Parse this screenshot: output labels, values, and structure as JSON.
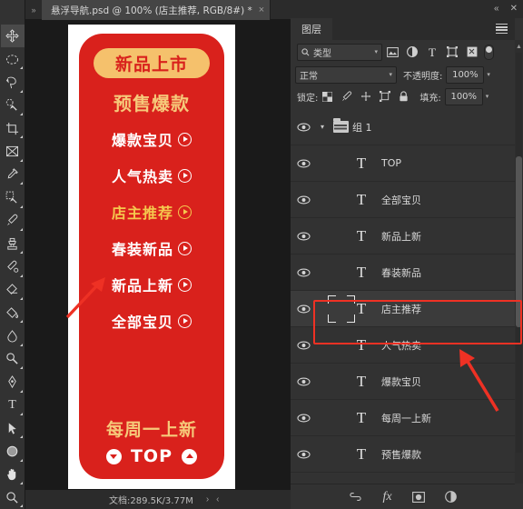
{
  "document": {
    "tab_title": "悬浮导航.psd @ 100% (店主推荐, RGB/8#) *",
    "close_label": "×",
    "nav_arrows_label": "»",
    "status_text": "文档:289.5K/3.77M",
    "status_next": "›",
    "status_prev": "‹"
  },
  "toolbar": {
    "tools": [
      {
        "name": "move-tool",
        "active": true
      },
      {
        "name": "elliptical-marquee-tool",
        "active": false
      },
      {
        "name": "lasso-tool",
        "active": false
      },
      {
        "name": "quick-selection-tool",
        "active": false
      },
      {
        "name": "crop-tool",
        "active": false
      },
      {
        "name": "frame-tool",
        "active": false
      },
      {
        "name": "eyedropper-tool",
        "active": false
      },
      {
        "name": "spot-healing-brush-tool",
        "active": false
      },
      {
        "name": "brush-tool",
        "active": false
      },
      {
        "name": "clone-stamp-tool",
        "active": false
      },
      {
        "name": "history-brush-tool",
        "active": false
      },
      {
        "name": "eraser-tool",
        "active": false
      },
      {
        "name": "paint-bucket-tool",
        "active": false
      },
      {
        "name": "blur-tool",
        "active": false
      },
      {
        "name": "dodge-tool",
        "active": false
      },
      {
        "name": "pen-tool",
        "active": false
      },
      {
        "name": "horizontal-type-tool",
        "active": false
      },
      {
        "name": "path-selection-tool",
        "active": false
      },
      {
        "name": "ellipse-shape-tool",
        "active": false
      },
      {
        "name": "hand-tool",
        "active": false
      },
      {
        "name": "zoom-tool",
        "active": false
      }
    ]
  },
  "canvas": {
    "pill_label": "新品上市",
    "headline": "预售爆款",
    "nav_items": [
      {
        "label": "爆款宝贝",
        "selected": false
      },
      {
        "label": "人气热卖",
        "selected": false
      },
      {
        "label": "店主推荐",
        "selected": true
      },
      {
        "label": "春装新品",
        "selected": false
      },
      {
        "label": "新品上新",
        "selected": false
      },
      {
        "label": "全部宝贝",
        "selected": false
      }
    ],
    "weekly_label": "每周一上新",
    "top_label": "TOP",
    "colors": {
      "banner_red": "#d9211c",
      "gold": "#f6c97a",
      "pill_bg": "#f5c16c",
      "selected_gold": "#f5c84e",
      "annotation_red": "#ef3124"
    }
  },
  "panel": {
    "tab_label": "图层",
    "collapse_label": "«",
    "close_label": "✕",
    "filter": {
      "search_icon": "search-icon",
      "type_label": "类型",
      "icons": [
        "pixel-layer-filter-icon",
        "adjustment-layer-filter-icon",
        "type-layer-filter-icon",
        "shape-layer-filter-icon",
        "smart-object-filter-icon"
      ]
    },
    "blend": {
      "mode": "正常",
      "opacity_label": "不透明度:",
      "opacity_value": "100%"
    },
    "lock": {
      "label": "锁定:",
      "icons": [
        "lock-transparent-pixels-icon",
        "lock-image-pixels-icon",
        "lock-position-icon",
        "lock-artboard-nesting-icon",
        "lock-all-icon"
      ],
      "fill_label": "填充:",
      "fill_value": "100%"
    },
    "layers": [
      {
        "name": "组 1",
        "kind": "group",
        "visible": true,
        "child": false,
        "selected": false
      },
      {
        "name": "TOP",
        "kind": "type",
        "visible": true,
        "child": true,
        "selected": false
      },
      {
        "name": "全部宝贝",
        "kind": "type",
        "visible": true,
        "child": true,
        "selected": false
      },
      {
        "name": "新品上新",
        "kind": "type",
        "visible": true,
        "child": true,
        "selected": false
      },
      {
        "name": "春装新品",
        "kind": "type",
        "visible": true,
        "child": true,
        "selected": false
      },
      {
        "name": "店主推荐",
        "kind": "type",
        "visible": true,
        "child": true,
        "selected": true
      },
      {
        "name": "人气热卖",
        "kind": "type",
        "visible": true,
        "child": true,
        "selected": false
      },
      {
        "name": "爆款宝贝",
        "kind": "type",
        "visible": true,
        "child": true,
        "selected": false
      },
      {
        "name": "每周一上新",
        "kind": "type",
        "visible": true,
        "child": true,
        "selected": false
      },
      {
        "name": "预售爆款",
        "kind": "type",
        "visible": true,
        "child": true,
        "selected": false
      }
    ],
    "bottom_icons": [
      "link-layers-icon",
      "add-layer-style-icon",
      "add-layer-mask-icon",
      "new-adjustment-layer-icon"
    ]
  }
}
